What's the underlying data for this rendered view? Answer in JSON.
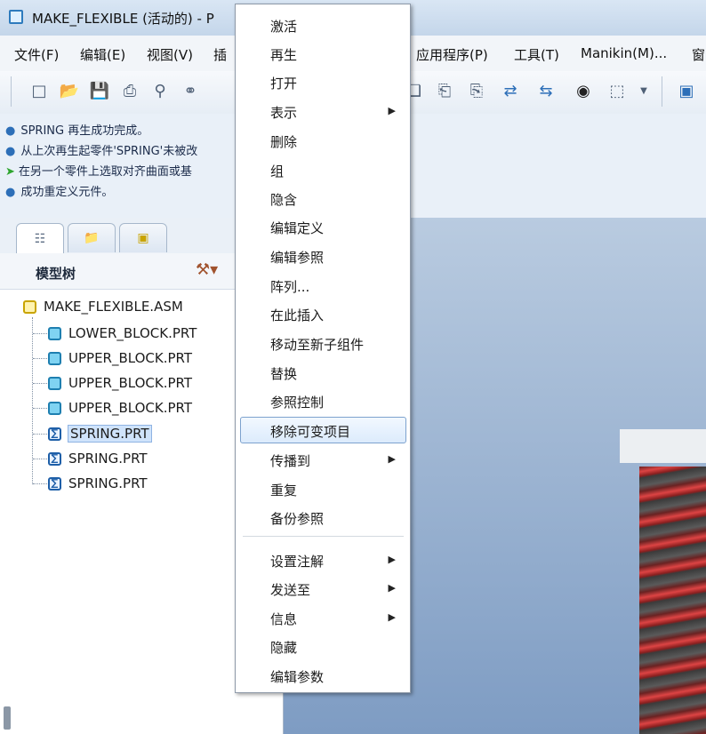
{
  "window": {
    "title": "MAKE_FLEXIBLE (活动的) - P"
  },
  "menubar": {
    "items": [
      "文件(F)",
      "编辑(E)",
      "视图(V)",
      "插",
      "应用程序(P)",
      "工具(T)",
      "Manikin(M)...",
      "窗"
    ]
  },
  "toolbar": {
    "icons": [
      "new-icon",
      "open-icon",
      "save-icon",
      "print-icon",
      "lock-icon",
      "link-icon",
      "copy-icon",
      "paste-icon",
      "paste-special-icon",
      "regenerate-icon",
      "regenerate-manager-icon",
      "find-icon",
      "select-box-icon",
      "dropdown-icon",
      "view-icon"
    ]
  },
  "messages": [
    {
      "type": "info",
      "text": "SPRING 再生成功完成。"
    },
    {
      "type": "info",
      "text": "从上次再生起零件'SPRING'未被改"
    },
    {
      "type": "prompt",
      "text": "在另一个零件上选取对齐曲面或基"
    },
    {
      "type": "info",
      "text": "成功重定义元件。"
    }
  ],
  "tree": {
    "title": "模型树",
    "root": "MAKE_FLEXIBLE.ASM",
    "children": [
      {
        "label": "LOWER_BLOCK.PRT",
        "kind": "part",
        "selected": false
      },
      {
        "label": "UPPER_BLOCK.PRT",
        "kind": "part",
        "selected": false
      },
      {
        "label": "UPPER_BLOCK.PRT",
        "kind": "part",
        "selected": false
      },
      {
        "label": "UPPER_BLOCK.PRT",
        "kind": "part",
        "selected": false
      },
      {
        "label": "SPRING.PRT",
        "kind": "flexible",
        "selected": true
      },
      {
        "label": "SPRING.PRT",
        "kind": "flexible",
        "selected": false
      },
      {
        "label": "SPRING.PRT",
        "kind": "flexible",
        "selected": false
      }
    ]
  },
  "context_menu": {
    "items": [
      {
        "label": "激活"
      },
      {
        "label": "再生"
      },
      {
        "label": "打开"
      },
      {
        "label": "表示",
        "submenu": true
      },
      {
        "label": "删除"
      },
      {
        "label": "组"
      },
      {
        "label": "隐含"
      },
      {
        "label": "编辑定义"
      },
      {
        "label": "编辑参照"
      },
      {
        "label": "阵列..."
      },
      {
        "label": "在此插入"
      },
      {
        "label": "移动至新子组件"
      },
      {
        "label": "替换"
      },
      {
        "label": "参照控制"
      },
      {
        "label": "移除可变项目",
        "highlighted": true
      },
      {
        "label": "传播到",
        "submenu": true
      },
      {
        "label": "重复"
      },
      {
        "label": "备份参照"
      },
      {
        "label": "设置注解",
        "submenu": true
      },
      {
        "label": "发送至",
        "submenu": true
      },
      {
        "label": "信息",
        "submenu": true
      },
      {
        "label": "隐藏"
      },
      {
        "label": "编辑参数"
      }
    ]
  },
  "colors": {
    "accent": "#2d6fb8",
    "selection": "#cfe3fb",
    "spring": "#c0302f"
  }
}
